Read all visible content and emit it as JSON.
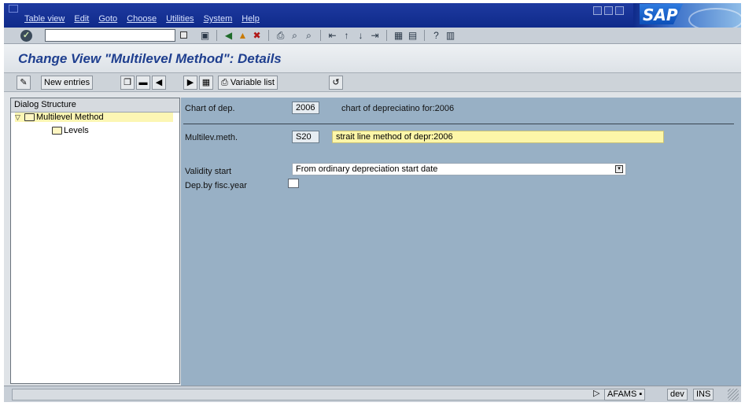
{
  "menu": {
    "items": [
      "Table view",
      "Edit",
      "Goto",
      "Choose",
      "Utilities",
      "System",
      "Help"
    ]
  },
  "brand": {
    "logo_text": "SAP",
    "title_bar_color": "#0f2a8a"
  },
  "std_toolbar": {
    "command_field_value": "",
    "icons": [
      "enter-icon",
      "save-icon",
      "back-icon",
      "exit-icon",
      "cancel-icon",
      "print-icon",
      "find-icon",
      "find-next-icon",
      "first-page-icon",
      "previous-page-icon",
      "next-page-icon",
      "last-page-icon",
      "new-session-icon",
      "shortcut-icon",
      "help-icon",
      "layout-icon"
    ]
  },
  "screen": {
    "title": "Change View \"Multilevel Method\": Details"
  },
  "app_toolbar": {
    "new_entries_label": "New entries",
    "variable_list_label": "Variable list"
  },
  "dialog_structure": {
    "header": "Dialog Structure",
    "nodes": [
      {
        "label": "Multilevel Method",
        "selected": true,
        "expanded": true
      },
      {
        "label": "Levels",
        "selected": false
      }
    ]
  },
  "details": {
    "chart_of_dep": {
      "label": "Chart of dep.",
      "value": "2006",
      "description": "chart of depreciatino for:2006"
    },
    "multilev_meth": {
      "label": "Multilev.meth.",
      "value": "S20",
      "description": "strait line method of depr:2006"
    },
    "validity_start": {
      "label": "Validity start",
      "value": "From ordinary depreciation start date"
    },
    "dep_by_fisc_year": {
      "label": "Dep.by fisc.year",
      "checked": false
    }
  },
  "status_bar": {
    "message": "",
    "transaction": "AFAMS",
    "client": "dev",
    "mode": "INS"
  }
}
